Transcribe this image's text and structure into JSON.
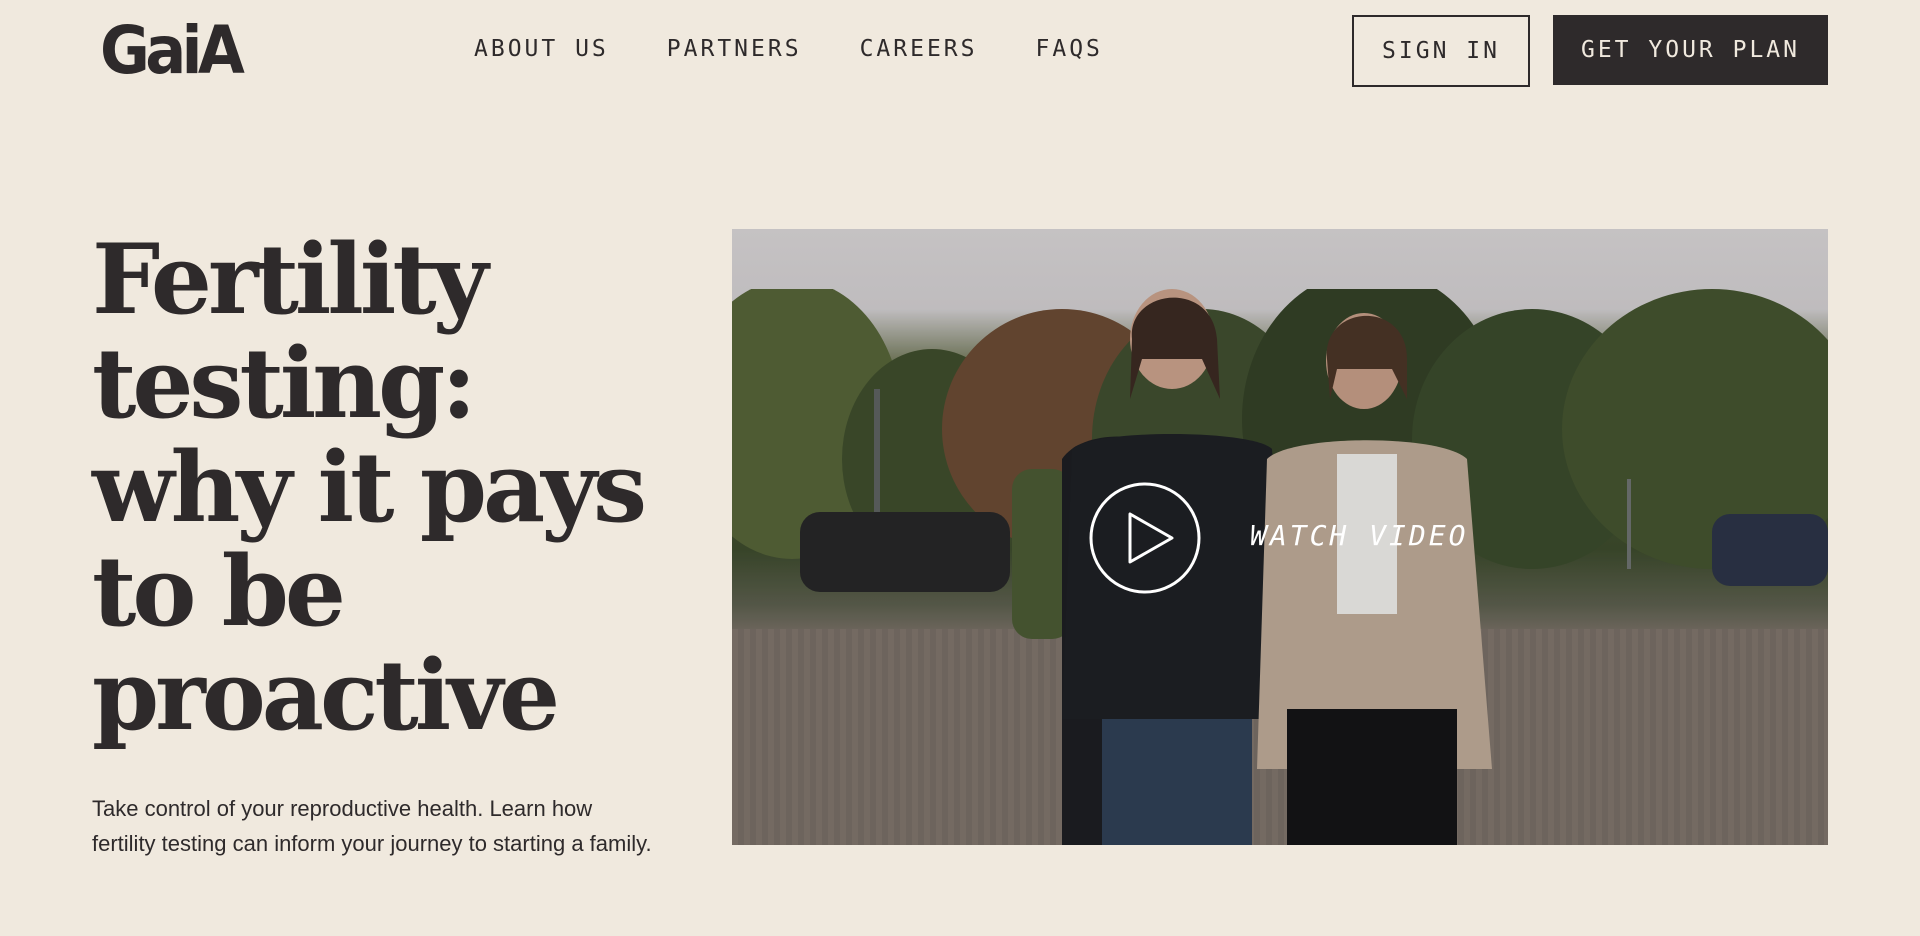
{
  "header": {
    "logo_text": "GaiA",
    "nav": [
      {
        "label": "ABOUT US"
      },
      {
        "label": "PARTNERS"
      },
      {
        "label": "CAREERS"
      },
      {
        "label": "FAQS"
      }
    ],
    "signin_label": "SIGN IN",
    "plan_label": "GET YOUR PLAN"
  },
  "hero": {
    "title_lines": [
      "Fertility",
      "testing:",
      "why it pays",
      "to be",
      "proactive"
    ],
    "subtitle": "Take control of your reproductive health. Learn how fertility testing can inform your journey to starting a family."
  },
  "video": {
    "watch_label": "WATCH VIDEO",
    "play_icon": "play-icon"
  },
  "colors": {
    "background": "#f0e9de",
    "text": "#2e2a2b",
    "button_dark": "#2e2a2b"
  }
}
